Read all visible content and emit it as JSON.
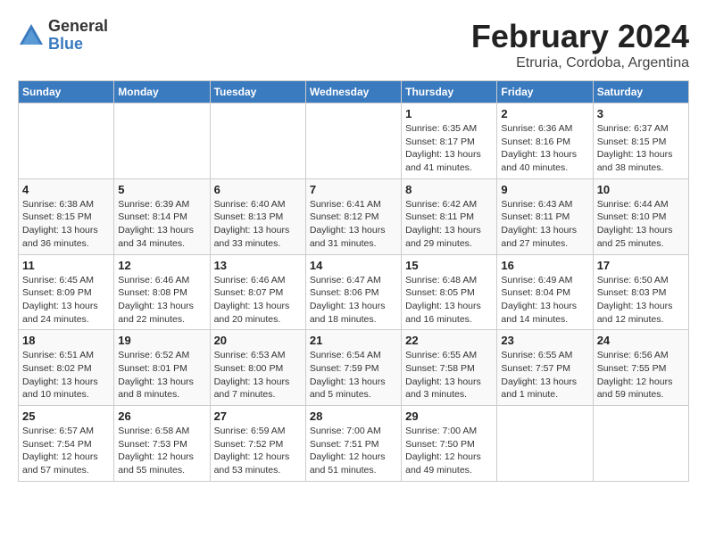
{
  "logo": {
    "general": "General",
    "blue": "Blue"
  },
  "header": {
    "title": "February 2024",
    "subtitle": "Etruria, Cordoba, Argentina"
  },
  "weekdays": [
    "Sunday",
    "Monday",
    "Tuesday",
    "Wednesday",
    "Thursday",
    "Friday",
    "Saturday"
  ],
  "weeks": [
    [
      {
        "day": "",
        "info": ""
      },
      {
        "day": "",
        "info": ""
      },
      {
        "day": "",
        "info": ""
      },
      {
        "day": "",
        "info": ""
      },
      {
        "day": "1",
        "info": "Sunrise: 6:35 AM\nSunset: 8:17 PM\nDaylight: 13 hours\nand 41 minutes."
      },
      {
        "day": "2",
        "info": "Sunrise: 6:36 AM\nSunset: 8:16 PM\nDaylight: 13 hours\nand 40 minutes."
      },
      {
        "day": "3",
        "info": "Sunrise: 6:37 AM\nSunset: 8:15 PM\nDaylight: 13 hours\nand 38 minutes."
      }
    ],
    [
      {
        "day": "4",
        "info": "Sunrise: 6:38 AM\nSunset: 8:15 PM\nDaylight: 13 hours\nand 36 minutes."
      },
      {
        "day": "5",
        "info": "Sunrise: 6:39 AM\nSunset: 8:14 PM\nDaylight: 13 hours\nand 34 minutes."
      },
      {
        "day": "6",
        "info": "Sunrise: 6:40 AM\nSunset: 8:13 PM\nDaylight: 13 hours\nand 33 minutes."
      },
      {
        "day": "7",
        "info": "Sunrise: 6:41 AM\nSunset: 8:12 PM\nDaylight: 13 hours\nand 31 minutes."
      },
      {
        "day": "8",
        "info": "Sunrise: 6:42 AM\nSunset: 8:11 PM\nDaylight: 13 hours\nand 29 minutes."
      },
      {
        "day": "9",
        "info": "Sunrise: 6:43 AM\nSunset: 8:11 PM\nDaylight: 13 hours\nand 27 minutes."
      },
      {
        "day": "10",
        "info": "Sunrise: 6:44 AM\nSunset: 8:10 PM\nDaylight: 13 hours\nand 25 minutes."
      }
    ],
    [
      {
        "day": "11",
        "info": "Sunrise: 6:45 AM\nSunset: 8:09 PM\nDaylight: 13 hours\nand 24 minutes."
      },
      {
        "day": "12",
        "info": "Sunrise: 6:46 AM\nSunset: 8:08 PM\nDaylight: 13 hours\nand 22 minutes."
      },
      {
        "day": "13",
        "info": "Sunrise: 6:46 AM\nSunset: 8:07 PM\nDaylight: 13 hours\nand 20 minutes."
      },
      {
        "day": "14",
        "info": "Sunrise: 6:47 AM\nSunset: 8:06 PM\nDaylight: 13 hours\nand 18 minutes."
      },
      {
        "day": "15",
        "info": "Sunrise: 6:48 AM\nSunset: 8:05 PM\nDaylight: 13 hours\nand 16 minutes."
      },
      {
        "day": "16",
        "info": "Sunrise: 6:49 AM\nSunset: 8:04 PM\nDaylight: 13 hours\nand 14 minutes."
      },
      {
        "day": "17",
        "info": "Sunrise: 6:50 AM\nSunset: 8:03 PM\nDaylight: 13 hours\nand 12 minutes."
      }
    ],
    [
      {
        "day": "18",
        "info": "Sunrise: 6:51 AM\nSunset: 8:02 PM\nDaylight: 13 hours\nand 10 minutes."
      },
      {
        "day": "19",
        "info": "Sunrise: 6:52 AM\nSunset: 8:01 PM\nDaylight: 13 hours\nand 8 minutes."
      },
      {
        "day": "20",
        "info": "Sunrise: 6:53 AM\nSunset: 8:00 PM\nDaylight: 13 hours\nand 7 minutes."
      },
      {
        "day": "21",
        "info": "Sunrise: 6:54 AM\nSunset: 7:59 PM\nDaylight: 13 hours\nand 5 minutes."
      },
      {
        "day": "22",
        "info": "Sunrise: 6:55 AM\nSunset: 7:58 PM\nDaylight: 13 hours\nand 3 minutes."
      },
      {
        "day": "23",
        "info": "Sunrise: 6:55 AM\nSunset: 7:57 PM\nDaylight: 13 hours\nand 1 minute."
      },
      {
        "day": "24",
        "info": "Sunrise: 6:56 AM\nSunset: 7:55 PM\nDaylight: 12 hours\nand 59 minutes."
      }
    ],
    [
      {
        "day": "25",
        "info": "Sunrise: 6:57 AM\nSunset: 7:54 PM\nDaylight: 12 hours\nand 57 minutes."
      },
      {
        "day": "26",
        "info": "Sunrise: 6:58 AM\nSunset: 7:53 PM\nDaylight: 12 hours\nand 55 minutes."
      },
      {
        "day": "27",
        "info": "Sunrise: 6:59 AM\nSunset: 7:52 PM\nDaylight: 12 hours\nand 53 minutes."
      },
      {
        "day": "28",
        "info": "Sunrise: 7:00 AM\nSunset: 7:51 PM\nDaylight: 12 hours\nand 51 minutes."
      },
      {
        "day": "29",
        "info": "Sunrise: 7:00 AM\nSunset: 7:50 PM\nDaylight: 12 hours\nand 49 minutes."
      },
      {
        "day": "",
        "info": ""
      },
      {
        "day": "",
        "info": ""
      }
    ]
  ]
}
